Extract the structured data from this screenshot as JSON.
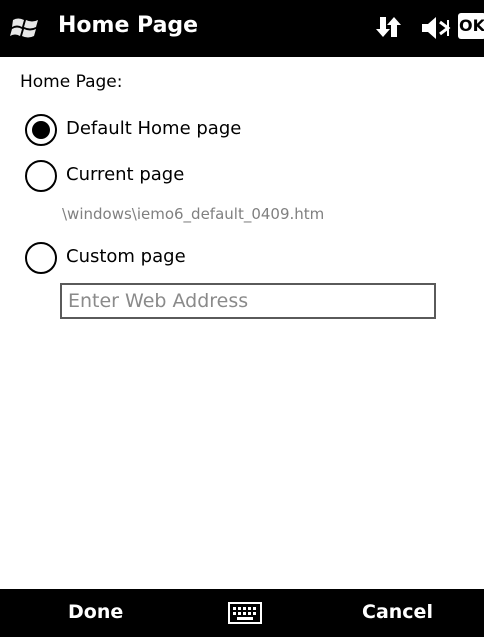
{
  "titlebar": {
    "title": "Home Page",
    "start_icon": "windows-flag-icon",
    "status": {
      "data_icon": "data-connection-icon",
      "volume_icon": "speaker-muted-icon",
      "ok_label": "OK"
    }
  },
  "content": {
    "section_label": "Home Page:",
    "options": [
      {
        "label": "Default Home page",
        "selected": true
      },
      {
        "label": "Current page",
        "selected": false
      },
      {
        "label": "Custom page",
        "selected": false
      }
    ],
    "current_page_path": "\\windows\\iemo6_default_0409.htm",
    "custom_address": {
      "value": "",
      "placeholder": "Enter Web Address"
    }
  },
  "softbar": {
    "left_label": "Done",
    "right_label": "Cancel",
    "keyboard_icon": "keyboard-icon"
  },
  "colors": {
    "bar_background": "#000000",
    "path_text": "#808080"
  }
}
